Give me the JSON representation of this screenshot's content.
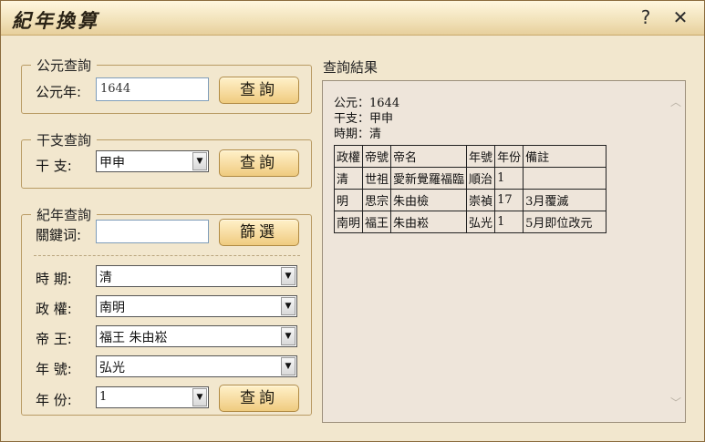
{
  "window": {
    "title": "紀年換算",
    "help": "?",
    "close": "✕"
  },
  "gregorian": {
    "legend": "公元查詢",
    "label": "公元年:",
    "value": "1644",
    "button": "查詢"
  },
  "ganzhi": {
    "legend": "干支查詢",
    "label": "干 支:",
    "value": "甲申",
    "button": "查詢"
  },
  "era": {
    "legend": "紀年查詢",
    "keyword_label": "關鍵词:",
    "keyword_value": "",
    "filter_button": "篩選",
    "period_label": "時 期:",
    "period_value": "清",
    "regime_label": "政 權:",
    "regime_value": "南明",
    "emperor_label": "帝 王:",
    "emperor_value": "福王 朱由崧",
    "reign_label": "年 號:",
    "reign_value": "弘光",
    "year_label": "年 份:",
    "year_value": "1",
    "button": "查詢"
  },
  "result": {
    "title": "查詢結果",
    "lines": [
      "公元：1644",
      "干支：甲申",
      "時期：清"
    ],
    "headers": [
      "政權",
      "帝號",
      "帝名",
      "年號",
      "年份",
      "備註"
    ],
    "rows": [
      [
        "清",
        "世祖",
        "愛新覺羅福臨",
        "順治",
        "1",
        ""
      ],
      [
        "明",
        "思宗",
        "朱由檢",
        "崇禎",
        "17",
        "3月覆滅"
      ],
      [
        "南明",
        "福王",
        "朱由崧",
        "弘光",
        "1",
        "5月即位改元"
      ]
    ]
  }
}
